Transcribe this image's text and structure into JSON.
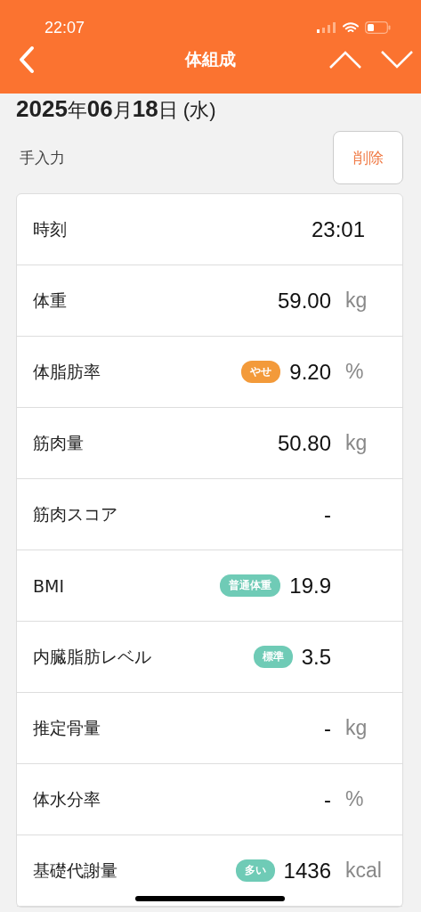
{
  "status_bar": {
    "time": "22:07"
  },
  "header": {
    "title": "体組成"
  },
  "date": {
    "year": "2025",
    "year_unit": "年",
    "month": "06",
    "month_unit": "月",
    "day": "18",
    "day_unit": "日",
    "weekday": "(水)"
  },
  "source": "手入力",
  "delete_button": "削除",
  "rows": [
    {
      "kind": "time",
      "label": "時刻",
      "value": "23:01"
    },
    {
      "kind": "measure",
      "label": "体重",
      "value": "59.00",
      "unit": "kg"
    },
    {
      "kind": "measure",
      "label": "体脂肪率",
      "badge": "やせ",
      "color": "#f39a3a",
      "value": "9.20",
      "unit": "%"
    },
    {
      "kind": "measure",
      "label": "筋肉量",
      "value": "50.80",
      "unit": "kg"
    },
    {
      "kind": "measure",
      "label": "筋肉スコア",
      "value": "-"
    },
    {
      "kind": "measure",
      "label": "BMI",
      "badge": "普通体重",
      "color": "#6fcbb6",
      "value": "19.9"
    },
    {
      "kind": "measure",
      "label": "内臓脂肪レベル",
      "badge": "標準",
      "color": "#6fcbb6",
      "value": "3.5"
    },
    {
      "kind": "measure",
      "label": "推定骨量",
      "value": "-",
      "unit": "kg"
    },
    {
      "kind": "measure",
      "label": "体水分率",
      "value": "-",
      "unit": "%"
    },
    {
      "kind": "measure",
      "label": "基礎代謝量",
      "badge": "多い",
      "color": "#6fcbb6",
      "value": "1436",
      "unit": "kcal"
    }
  ]
}
